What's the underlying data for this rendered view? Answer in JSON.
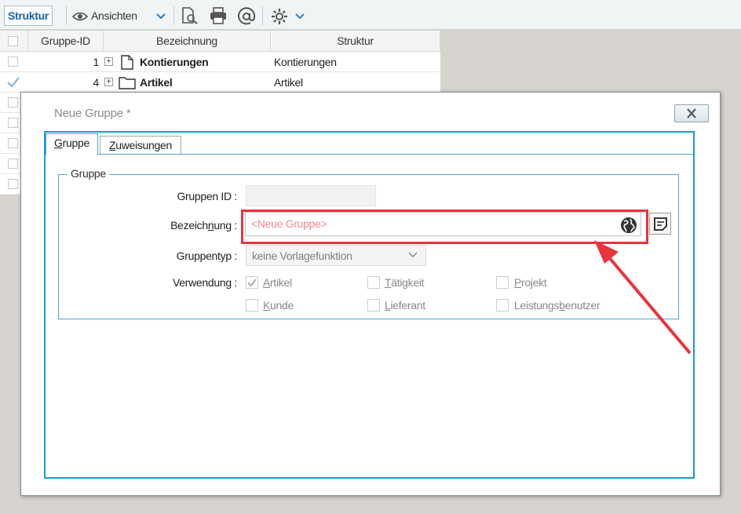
{
  "toolbar": {
    "struktur_label": "Struktur",
    "ansichten_label": "Ansichten"
  },
  "grid": {
    "columns": [
      "Gruppe-ID",
      "Bezeichnung",
      "Struktur"
    ],
    "rows": [
      {
        "id": "1",
        "name": "Kontierungen",
        "struktur": "Kontierungen",
        "icon": "file-icon",
        "checked": false
      },
      {
        "id": "4",
        "name": "Artikel",
        "struktur": "Artikel",
        "icon": "folder-icon",
        "checked": true
      }
    ]
  },
  "dialog": {
    "title": "Neue Gruppe *",
    "tabs": [
      {
        "label": "Gruppe",
        "underline": "G",
        "rest": "ruppe",
        "active": true
      },
      {
        "label": "Zuweisungen",
        "underline": "Z",
        "rest": "uweisungen",
        "active": false
      }
    ],
    "group_legend": "Gruppe",
    "labels": {
      "gruppen_id": "Gruppen ID :",
      "bezeichnung_pre": "Bezeich",
      "bezeichnung_u": "n",
      "bezeichnung_post": "ung :",
      "gruppentyp": "Gruppentyp :",
      "verwendung": "Verwendung :"
    },
    "bezeichnung_placeholder": "<Neue Gruppe>",
    "gruppentyp_value": "keine Vorlagefunktion",
    "verwendung": [
      {
        "pre": "",
        "u": "A",
        "post": "rtikel",
        "checked": true
      },
      {
        "pre": "",
        "u": "T",
        "post": "ätigkeit",
        "checked": false
      },
      {
        "pre": "",
        "u": "P",
        "post": "rojekt",
        "checked": false
      },
      {
        "pre": "",
        "u": "K",
        "post": "unde",
        "checked": false
      },
      {
        "pre": "",
        "u": "L",
        "post": "ieferant",
        "checked": false
      },
      {
        "pre": "Leistungs",
        "u": "b",
        "post": "enutzer",
        "checked": false
      }
    ]
  },
  "colors": {
    "accent": "#1a9bd1",
    "highlight": "#e8343c",
    "placeholder": "#f28b8b"
  }
}
